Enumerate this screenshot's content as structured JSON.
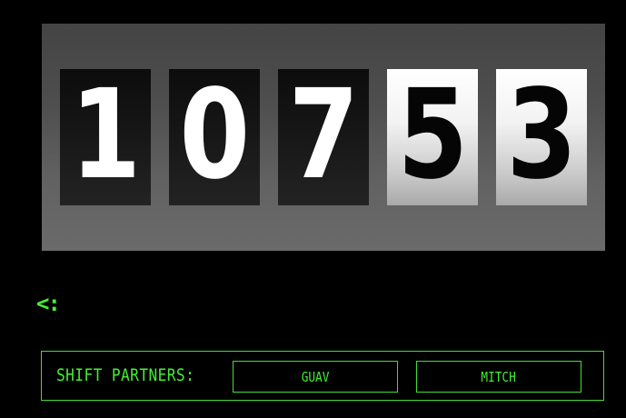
{
  "counter": {
    "digits": [
      {
        "value": "1",
        "style": "dark"
      },
      {
        "value": "0",
        "style": "dark"
      },
      {
        "value": "7",
        "style": "dark"
      },
      {
        "value": "5",
        "style": "light"
      },
      {
        "value": "3",
        "style": "light"
      }
    ]
  },
  "nav": {
    "back_label": "<:"
  },
  "partners": {
    "label": "SHIFT PARTNERS:",
    "names": [
      "GUAV",
      "MITCH"
    ]
  },
  "colors": {
    "accent": "#44ee33",
    "background": "#000000",
    "panel": "#555555"
  }
}
